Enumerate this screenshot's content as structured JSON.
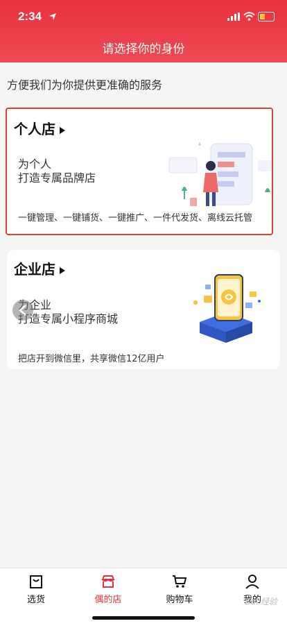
{
  "status_bar": {
    "time": "2:34"
  },
  "header": {
    "title": "请选择你的身份"
  },
  "subtitle": "方便我们为你提供更准确的服务",
  "personal": {
    "title": "个人店",
    "line1": "为个人",
    "line2": "打造专属品牌店",
    "features": "一键管理、一键铺货、一键推广、一件代发货、离线云托管"
  },
  "enterprise": {
    "title": "企业店",
    "line1": "为企业",
    "line2": "打造专属小程序商城",
    "features": "把店开到微信里，共享微信12亿用户"
  },
  "tabs": [
    {
      "label": "选货",
      "icon": "shopping-bag-icon"
    },
    {
      "label": "偶的店",
      "icon": "store-icon",
      "active": true
    },
    {
      "label": "购物车",
      "icon": "cart-icon"
    },
    {
      "label": "我的",
      "icon": "user-icon"
    }
  ],
  "watermark": "Bai 经验",
  "colors": {
    "brand": "#e8303e",
    "highlight_border": "#e63b3b"
  }
}
